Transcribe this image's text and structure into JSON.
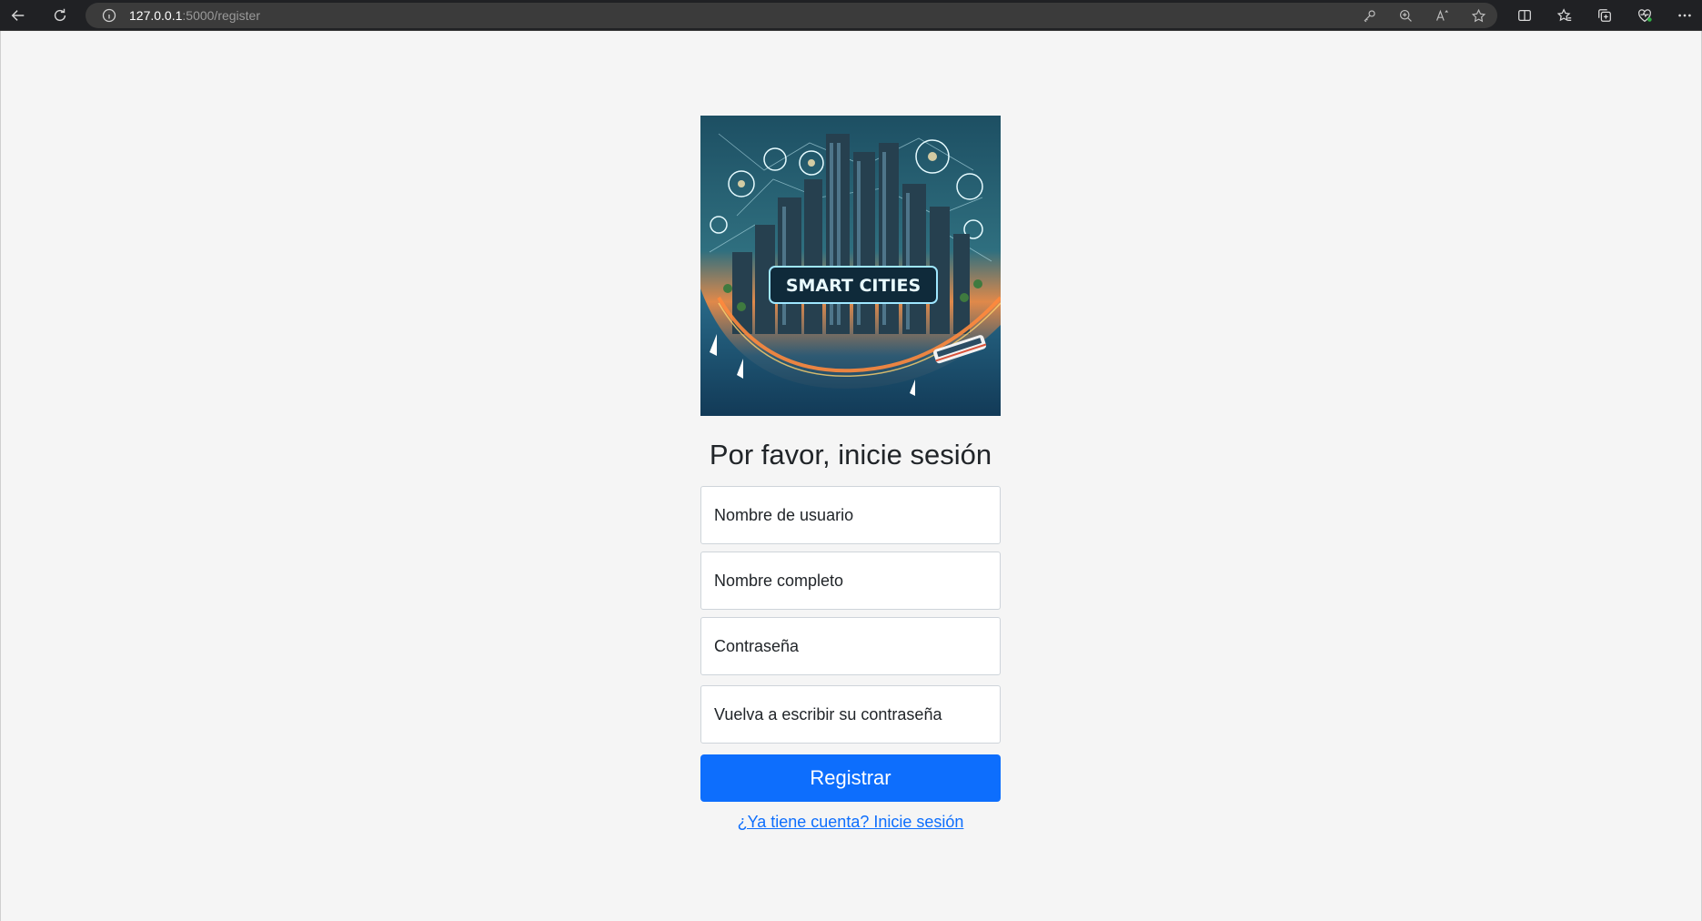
{
  "browser": {
    "url_host": "127.0.0.1",
    "url_path": ":5000/register"
  },
  "hero": {
    "banner_text": "SMART CITIES"
  },
  "form": {
    "heading": "Por favor, inicie sesión",
    "username_placeholder": "Nombre de usuario",
    "fullname_placeholder": "Nombre completo",
    "password_placeholder": "Contraseña",
    "confirm_placeholder": "Vuelva a escribir su contraseña",
    "submit_label": "Registrar",
    "login_link": "¿Ya tiene cuenta? Inicie sesión"
  },
  "colors": {
    "primary": "#0d6efd",
    "page_bg": "#f5f5f5",
    "chrome_bg": "#202124"
  }
}
